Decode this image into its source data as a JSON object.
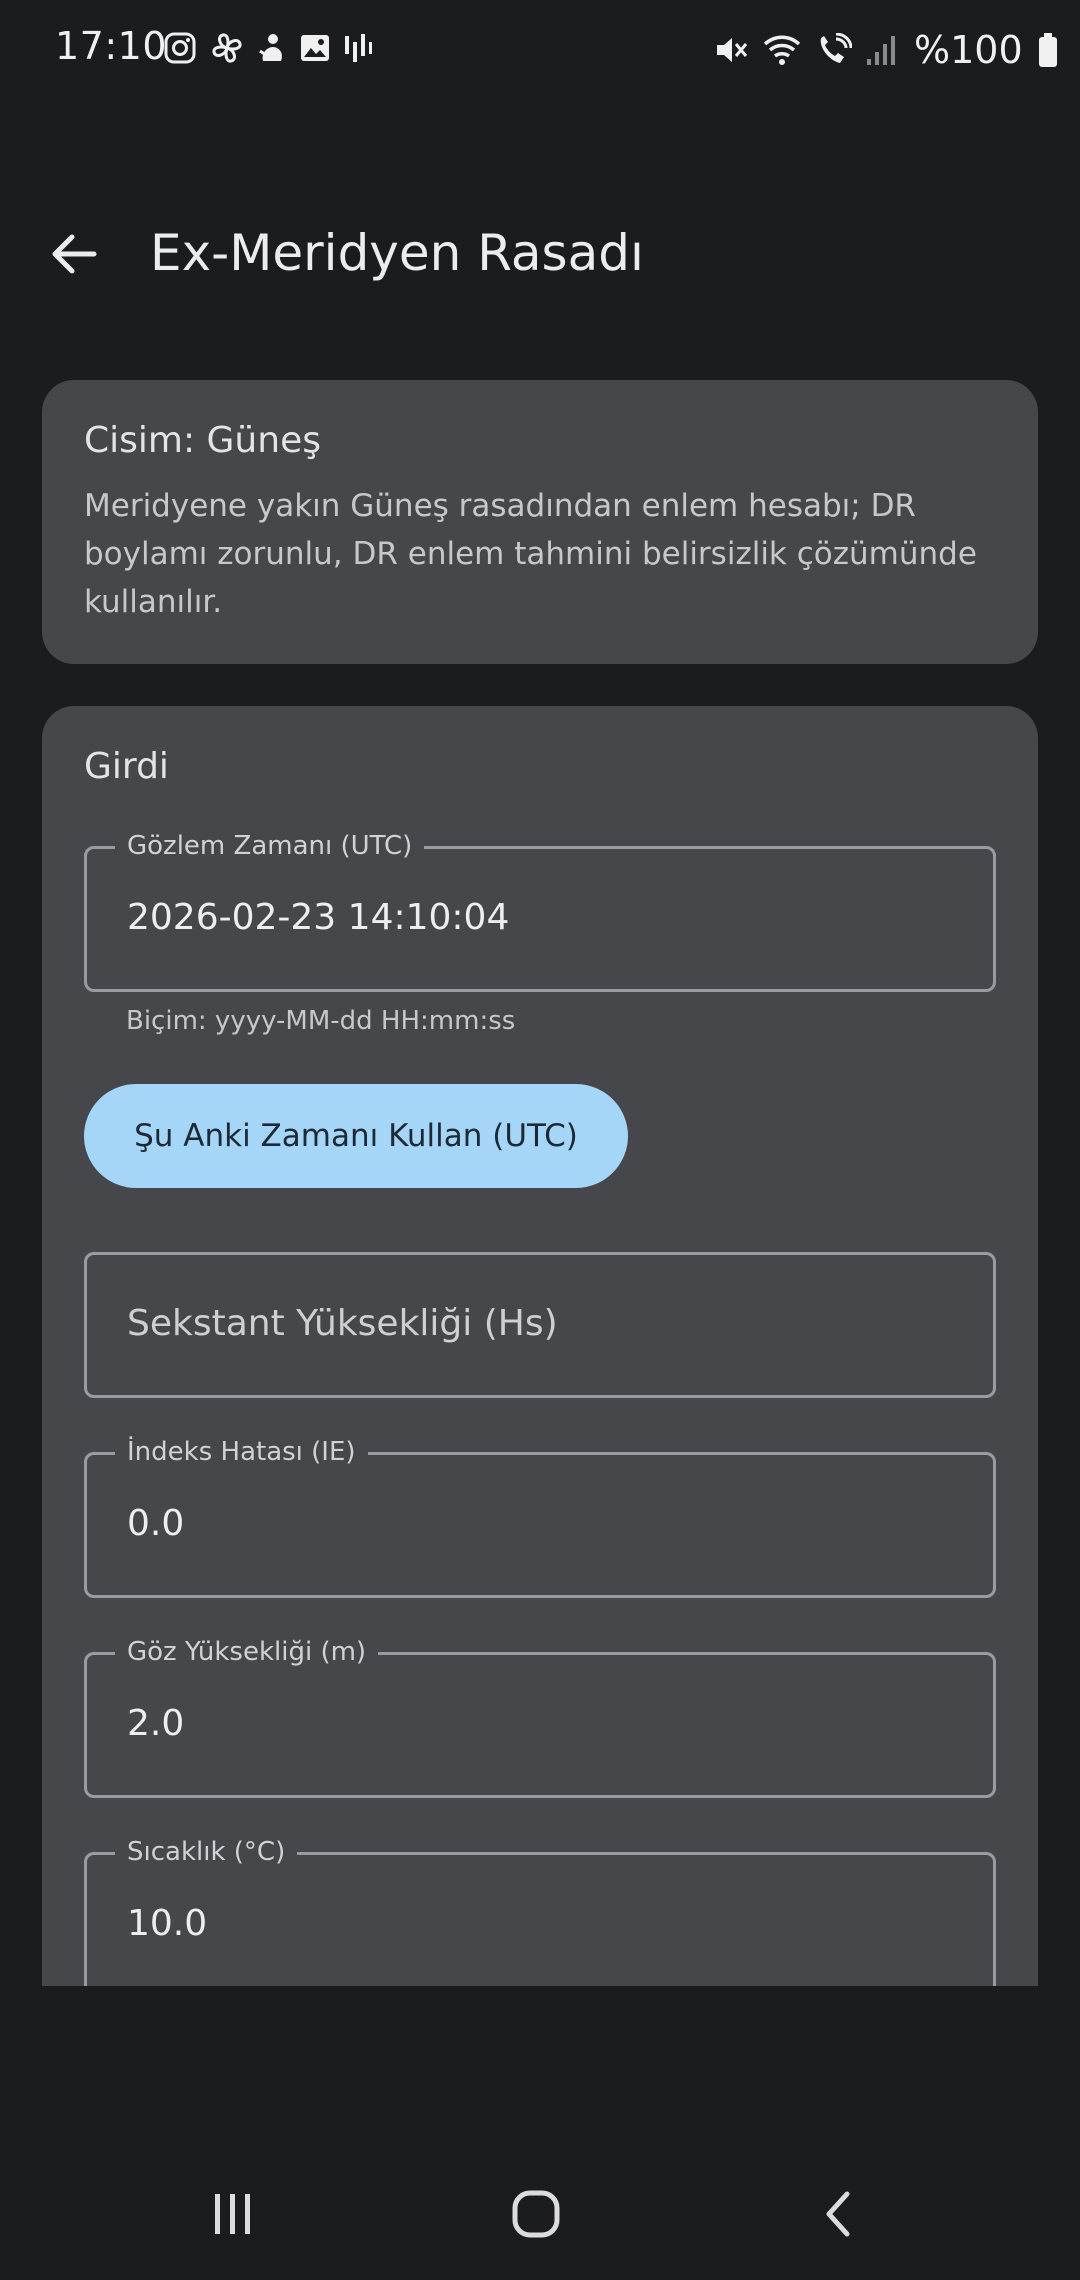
{
  "status_bar": {
    "time": "17:10",
    "battery": "%100",
    "left_icons": [
      "instagram-icon",
      "pinwheel-icon",
      "notification-app-icon",
      "gallery-icon",
      "audio-bars-icon"
    ],
    "right_icons": [
      "mute-icon",
      "wifi-icon",
      "wifi-call-icon",
      "signal-icon",
      "battery-icon"
    ]
  },
  "app_bar": {
    "title": "Ex-Meridyen Rasadı",
    "back_icon": "arrow-back-icon"
  },
  "info_card": {
    "title": "Cisim: Güneş",
    "description": "Meridyene yakın Güneş rasadından enlem hesabı; DR boylamı zorunlu, DR enlem tahmini belirsizlik çözümünde kullanılır."
  },
  "input_card": {
    "title": "Girdi",
    "observation_time": {
      "label": "Gözlem Zamanı (UTC)",
      "value": "2026-02-23 14:10:04",
      "helper": "Biçim: yyyy-MM-dd HH:mm:ss"
    },
    "use_now_button": "Şu Anki Zamanı Kullan (UTC)",
    "sextant_height": {
      "placeholder": "Sekstant Yüksekliği (Hs)"
    },
    "index_error": {
      "label": "İndeks Hatası (IE)",
      "value": "0.0"
    },
    "eye_height": {
      "label": "Göz Yüksekliği (m)",
      "value": "2.0"
    },
    "temperature": {
      "label": "Sıcaklık (°C)",
      "value": "10.0"
    }
  },
  "nav_bar": {
    "items": [
      "recent-apps-icon",
      "home-icon",
      "back-icon"
    ]
  }
}
